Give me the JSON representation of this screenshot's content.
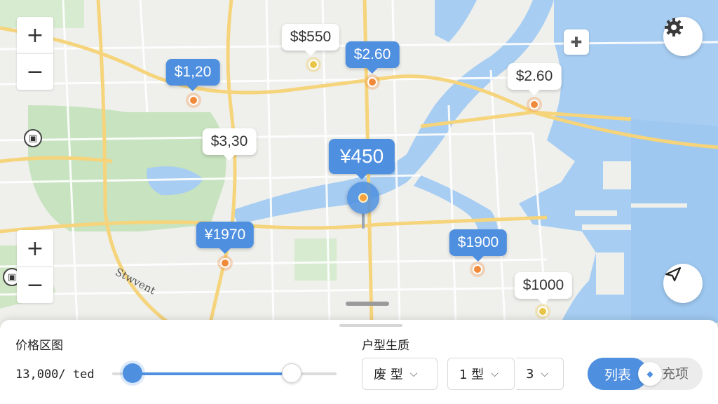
{
  "map": {
    "zoom_in_symbol": "+",
    "zoom_out_symbol": "−",
    "street_label": "Stwvent",
    "settings_icon": "gear-icon",
    "locate_icon": "location-arrow-icon",
    "transit_icon": "bus-icon",
    "poi_icon": "puzzle-icon",
    "markers": [
      {
        "label": "$$550",
        "style": "white",
        "dot": "yellow"
      },
      {
        "label": "$1,20",
        "style": "blue",
        "dot": "orange"
      },
      {
        "label": "$2.60",
        "style": "blue",
        "dot": "orange"
      },
      {
        "label": "$2.60",
        "style": "white",
        "dot": "orange"
      },
      {
        "label": "$3,30",
        "style": "white",
        "dot": "yellow"
      },
      {
        "label": "¥450",
        "style": "blue",
        "dot": "selected"
      },
      {
        "label": "¥1970",
        "style": "blue",
        "dot": "orange"
      },
      {
        "label": "$1900",
        "style": "blue",
        "dot": "orange"
      },
      {
        "label": "$1000",
        "style": "white",
        "dot": "yellow"
      }
    ]
  },
  "panel": {
    "price_range_label": "价格区图",
    "price_value": "13,000/ ted",
    "price_slider": {
      "min_fraction": 0.09,
      "max_fraction": 0.8
    },
    "house_type_label": "户型生质",
    "selects": [
      {
        "value": "废 型",
        "icon": "chevron-down-icon"
      },
      {
        "value": "1 型",
        "icon": "chevron-down-icon"
      },
      {
        "value": "3",
        "icon": "chevron-down-icon"
      }
    ],
    "view_toggle": {
      "active": "列表",
      "inactive": "充项"
    }
  },
  "colors": {
    "accent": "#4e8fe0",
    "orange_dot": "#f08a3a",
    "water": "#a7cdf2",
    "park": "#c8e3bf",
    "road": "#f5d47c"
  }
}
